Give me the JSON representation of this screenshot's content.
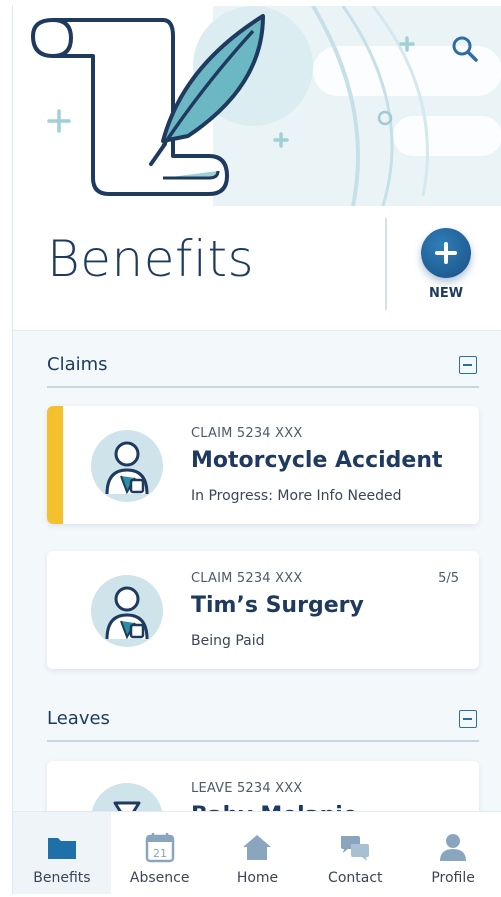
{
  "header": {
    "search_icon": "search-icon",
    "illustration": "scroll-and-quill-illustration"
  },
  "title": {
    "text": "Benefits",
    "new_label": "NEW",
    "new_icon": "plus-icon"
  },
  "sections": {
    "claims": {
      "title": "Claims",
      "collapse_icon": "minus-square-icon",
      "cards": [
        {
          "id": "CLAIM 5234 XXX",
          "title": "Motorcycle Accident",
          "status": "In Progress: More Info Needed",
          "count": "",
          "accent_color": "#f4c02d"
        },
        {
          "id": "CLAIM 5234 XXX",
          "title": "Tim’s Surgery",
          "status": "Being Paid",
          "count": "5/5"
        }
      ]
    },
    "leaves": {
      "title": "Leaves",
      "collapse_icon": "minus-square-icon",
      "cards": [
        {
          "id": "LEAVE 5234 XXX",
          "title": "Baby Melanie"
        }
      ]
    }
  },
  "bottom_nav": {
    "items": [
      {
        "label": "Benefits",
        "icon": "folder-icon",
        "active": true
      },
      {
        "label": "Absence",
        "icon": "calendar-icon",
        "calendar_day": "21"
      },
      {
        "label": "Home",
        "icon": "home-icon"
      },
      {
        "label": "Contact",
        "icon": "chat-bubbles-icon"
      },
      {
        "label": "Profile",
        "icon": "person-icon"
      }
    ]
  },
  "colors": {
    "primary": "#1f3a5f",
    "accent_blue": "#2e6da4",
    "warning": "#f4c02d",
    "teal": "#6bb8c4",
    "background": "#f3f8fb"
  }
}
